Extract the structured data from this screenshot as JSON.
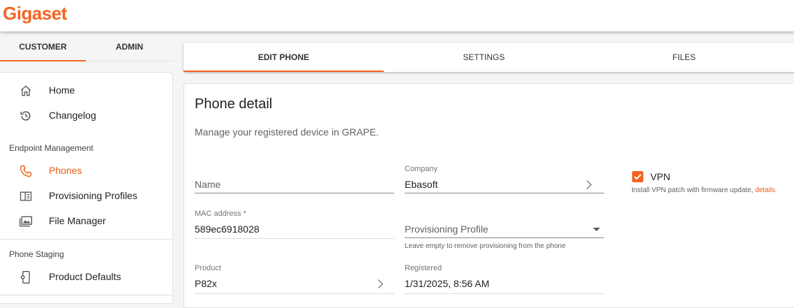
{
  "app": {
    "logo": "Gigaset",
    "brand_color": "#f26522"
  },
  "sidebar": {
    "tabs": [
      {
        "label": "CUSTOMER",
        "active": true
      },
      {
        "label": "ADMIN",
        "active": false
      }
    ],
    "top_items": [
      {
        "label": "Home",
        "icon": "home-icon"
      },
      {
        "label": "Changelog",
        "icon": "history-icon"
      }
    ],
    "sections": [
      {
        "title": "Endpoint Management",
        "items": [
          {
            "label": "Phones",
            "icon": "phone-icon",
            "active": true
          },
          {
            "label": "Provisioning Profiles",
            "icon": "profile-icon"
          },
          {
            "label": "File Manager",
            "icon": "folder-image-icon"
          }
        ]
      },
      {
        "title": "Phone Staging",
        "items": [
          {
            "label": "Product Defaults",
            "icon": "device-settings-icon"
          }
        ]
      }
    ]
  },
  "main": {
    "tabs": [
      {
        "label": "EDIT PHONE",
        "active": true
      },
      {
        "label": "SETTINGS"
      },
      {
        "label": "FILES"
      }
    ],
    "title": "Phone detail",
    "subtitle": "Manage your registered device in GRAPE.",
    "fields": {
      "name": {
        "placeholder": "Name",
        "value": ""
      },
      "company": {
        "label": "Company",
        "value": "Ebasoft"
      },
      "vpn": {
        "label": "VPN",
        "checked": true,
        "hint": "Install VPN patch with firmware update, ",
        "link": "details"
      },
      "mac": {
        "label": "MAC address *",
        "value": "589ec6918028"
      },
      "provisioning": {
        "placeholder": "Provisioning Profile",
        "hint": "Leave empty to remove provisioning from the phone"
      },
      "product": {
        "label": "Product",
        "value": "P82x"
      },
      "registered": {
        "label": "Registered",
        "value": "1/31/2025, 8:56 AM"
      }
    }
  }
}
